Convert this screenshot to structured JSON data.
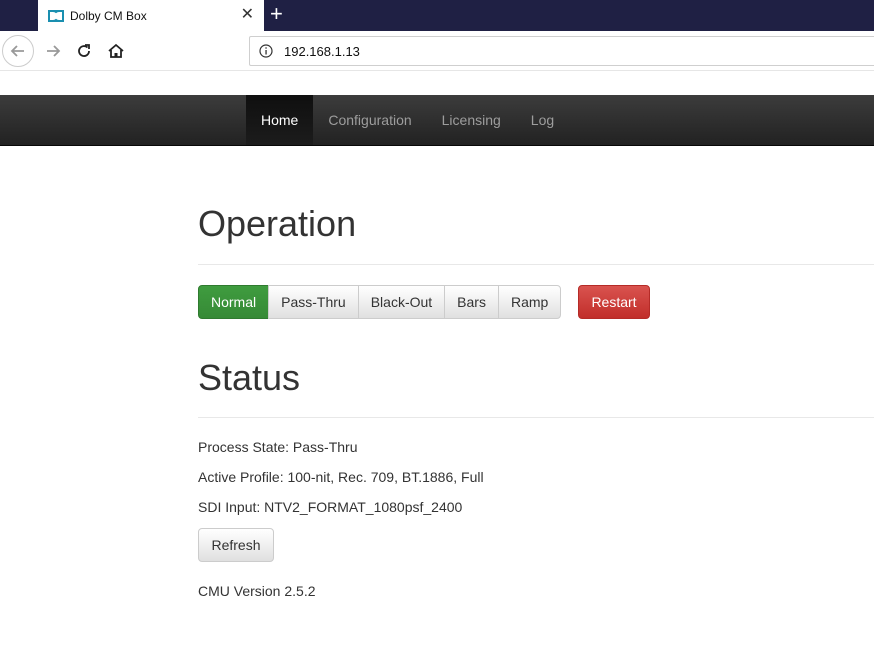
{
  "browser": {
    "tab_title": "Dolby CM Box",
    "url": "192.168.1.13",
    "new_tab": "+",
    "close": "✕"
  },
  "navbar": {
    "items": [
      {
        "label": "Home",
        "active": true
      },
      {
        "label": "Configuration",
        "active": false
      },
      {
        "label": "Licensing",
        "active": false
      },
      {
        "label": "Log",
        "active": false
      }
    ]
  },
  "operation": {
    "heading": "Operation",
    "modes": [
      "Normal",
      "Pass-Thru",
      "Black-Out",
      "Bars",
      "Ramp"
    ],
    "selected_mode": "Normal",
    "restart_label": "Restart"
  },
  "status": {
    "heading": "Status",
    "process_state": "Process State: Pass-Thru",
    "active_profile": "Active Profile: 100-nit, Rec. 709, BT.1886, Full",
    "sdi_input": "SDI Input: NTV2_FORMAT_1080psf_2400",
    "refresh_label": "Refresh",
    "version": "CMU Version 2.5.2"
  },
  "colors": {
    "success": "#3a933a",
    "danger": "#cc3a36",
    "navbar": "#2b2b2b",
    "tabbar": "#1f2044"
  }
}
